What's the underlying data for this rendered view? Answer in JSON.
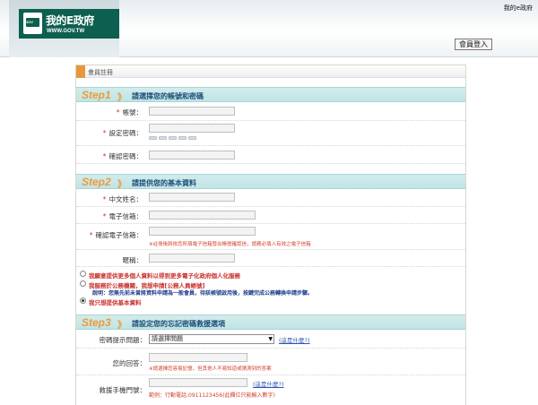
{
  "header": {
    "logo_title": "我的E政府",
    "logo_url": "WWW.GOV.TW",
    "logo_mark": "GOV",
    "top_link": "我的e政府",
    "login_button": "會員登入"
  },
  "panel": {
    "title": "會員註冊"
  },
  "step1": {
    "number": "Step1",
    "arrow": "》",
    "title": "請選擇您的帳號和密碼",
    "fields": [
      {
        "label": "帳號：",
        "required": "*"
      },
      {
        "label": "設定密碼：",
        "required": "*"
      },
      {
        "label": "確認密碼：",
        "required": "*"
      }
    ]
  },
  "step2": {
    "number": "Step2",
    "arrow": "》",
    "title": "請提供您的基本資料",
    "fields": [
      {
        "label": "中文姓名：",
        "required": "*"
      },
      {
        "label": "電子信箱：",
        "required": "*"
      },
      {
        "label": "確認電子信箱：",
        "required": "*"
      },
      {
        "label": "暱稱：",
        "required": ""
      }
    ],
    "email_note": "※註冊後將依您所填電子信箱發出帳號確認信，請務必填入有效之電子信箱",
    "options": [
      {
        "text": "我願意提供更多個人資料以得到更多電子化政府個人化服務",
        "selected": false
      },
      {
        "text": "我服務於公務機關，我想申請[公務人員帳號]",
        "selected": false,
        "sub": "說明：您無先前未曾將資料申請為一般會員，待該帳號啟用後，按鍵完成公務轉換申請步驟。"
      },
      {
        "text": "我只想提供基本資料",
        "selected": true
      }
    ]
  },
  "step3": {
    "number": "Step3",
    "arrow": "》",
    "title": "請設定您的忘記密碼救援選項",
    "question_label": "密碼提示問題：",
    "question_select": "請選擇問題",
    "question_link": "(這是什麼?)",
    "answer_label": "您的回答：",
    "answer_note": "※請選擇您容易記憶，但其他人不易知道或猜測到的答案",
    "phone_label": "救援手機門號：",
    "phone_link": "(這是什麼?)",
    "phone_example": "範例：行動電話:0911123456(此欄位只能輸入數字)"
  },
  "colors": {
    "step_bg": "#c8e8e8",
    "step_number": "#ef9a3a",
    "step_title": "#1c4e7a",
    "required": "#d13b1f",
    "logo_bg": "#0d5f50"
  }
}
